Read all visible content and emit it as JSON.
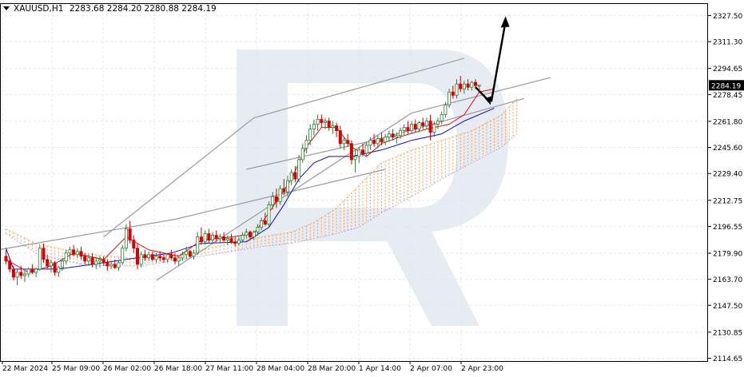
{
  "header": {
    "symbol": "XAUUSD,H1",
    "ohlc": "2283.68 2284.20 2280.88 2284.19"
  },
  "colors": {
    "grid": "#e4e4ec",
    "frame": "#000000",
    "candle_up": "#2e7d32",
    "candle_down": "#d50000",
    "tenkan": "#e01010",
    "kijun": "#1010c0",
    "cloud_a": "#f0a060",
    "cloud_b": "#b090e0",
    "channel": "#9a9a9a",
    "arrow": "#000000",
    "price_tag": "#000000",
    "watermark": "#dfe4ee"
  },
  "chart_data": {
    "type": "candlestick",
    "ylim": [
      2114.65,
      2334
    ],
    "yticks": [
      "2327.50",
      "2311.30",
      "2294.65",
      "2278.45",
      "2261.80",
      "2245.60",
      "2229.40",
      "2212.75",
      "2196.55",
      "2179.90",
      "2163.70",
      "2147.50",
      "2130.85",
      "2114.65"
    ],
    "xticks": [
      "22 Mar 2024",
      "25 Mar 09:00",
      "26 Mar 02:00",
      "26 Mar 18:00",
      "27 Mar 11:00",
      "28 Mar 04:00",
      "28 Mar 20:00",
      "1 Apr 14:00",
      "2 Apr 07:00",
      "2 Apr 23:00"
    ],
    "current_price": "2284.19",
    "bars": [
      [
        2178,
        2182,
        2173,
        2175
      ],
      [
        2175,
        2177,
        2168,
        2170
      ],
      [
        2170,
        2172,
        2163,
        2165
      ],
      [
        2165,
        2170,
        2160,
        2168
      ],
      [
        2168,
        2172,
        2164,
        2166
      ],
      [
        2166,
        2169,
        2162,
        2167
      ],
      [
        2167,
        2171,
        2165,
        2170
      ],
      [
        2170,
        2173,
        2167,
        2168
      ],
      [
        2168,
        2171,
        2165,
        2170
      ],
      [
        2170,
        2185,
        2169,
        2183
      ],
      [
        2183,
        2186,
        2174,
        2176
      ],
      [
        2176,
        2179,
        2170,
        2172
      ],
      [
        2172,
        2176,
        2168,
        2174
      ],
      [
        2174,
        2175,
        2166,
        2168
      ],
      [
        2168,
        2172,
        2165,
        2171
      ],
      [
        2171,
        2177,
        2169,
        2175
      ],
      [
        2175,
        2182,
        2173,
        2180
      ],
      [
        2180,
        2184,
        2176,
        2182
      ],
      [
        2182,
        2185,
        2178,
        2179
      ],
      [
        2179,
        2183,
        2177,
        2181
      ],
      [
        2181,
        2184,
        2176,
        2178
      ],
      [
        2178,
        2180,
        2173,
        2175
      ],
      [
        2175,
        2179,
        2172,
        2177
      ],
      [
        2177,
        2180,
        2171,
        2173
      ],
      [
        2173,
        2177,
        2170,
        2175
      ],
      [
        2175,
        2178,
        2171,
        2176
      ],
      [
        2176,
        2178,
        2172,
        2174
      ],
      [
        2174,
        2176,
        2169,
        2172
      ],
      [
        2172,
        2175,
        2170,
        2173
      ],
      [
        2173,
        2176,
        2170,
        2171
      ],
      [
        2171,
        2175,
        2169,
        2174
      ],
      [
        2174,
        2185,
        2173,
        2183
      ],
      [
        2183,
        2198,
        2181,
        2195
      ],
      [
        2195,
        2200,
        2186,
        2188
      ],
      [
        2188,
        2191,
        2180,
        2183
      ],
      [
        2183,
        2186,
        2170,
        2173
      ],
      [
        2173,
        2181,
        2171,
        2179
      ],
      [
        2179,
        2182,
        2175,
        2177
      ],
      [
        2177,
        2181,
        2175,
        2179
      ],
      [
        2179,
        2181,
        2175,
        2176
      ],
      [
        2176,
        2180,
        2174,
        2178
      ],
      [
        2178,
        2181,
        2175,
        2177
      ],
      [
        2177,
        2179,
        2174,
        2176
      ],
      [
        2176,
        2180,
        2174,
        2179
      ],
      [
        2179,
        2182,
        2176,
        2177
      ],
      [
        2177,
        2180,
        2173,
        2175
      ],
      [
        2175,
        2178,
        2172,
        2177
      ],
      [
        2177,
        2181,
        2175,
        2179
      ],
      [
        2179,
        2184,
        2176,
        2181
      ],
      [
        2181,
        2182,
        2177,
        2178
      ],
      [
        2178,
        2182,
        2176,
        2180
      ],
      [
        2180,
        2193,
        2179,
        2190
      ],
      [
        2190,
        2196,
        2185,
        2187
      ],
      [
        2187,
        2194,
        2185,
        2192
      ],
      [
        2192,
        2195,
        2186,
        2188
      ],
      [
        2188,
        2193,
        2186,
        2191
      ],
      [
        2191,
        2194,
        2187,
        2189
      ],
      [
        2189,
        2192,
        2186,
        2190
      ],
      [
        2190,
        2193,
        2187,
        2188
      ],
      [
        2188,
        2191,
        2185,
        2189
      ],
      [
        2189,
        2192,
        2186,
        2187
      ],
      [
        2187,
        2190,
        2184,
        2186
      ],
      [
        2186,
        2190,
        2185,
        2188
      ],
      [
        2188,
        2193,
        2187,
        2191
      ],
      [
        2191,
        2195,
        2189,
        2193
      ],
      [
        2193,
        2194,
        2188,
        2190
      ],
      [
        2190,
        2194,
        2188,
        2193
      ],
      [
        2193,
        2198,
        2191,
        2196
      ],
      [
        2196,
        2202,
        2194,
        2200
      ],
      [
        2200,
        2205,
        2197,
        2198
      ],
      [
        2198,
        2212,
        2196,
        2210
      ],
      [
        2210,
        2218,
        2207,
        2215
      ],
      [
        2215,
        2220,
        2208,
        2212
      ],
      [
        2212,
        2222,
        2210,
        2220
      ],
      [
        2220,
        2226,
        2216,
        2218
      ],
      [
        2218,
        2228,
        2215,
        2225
      ],
      [
        2225,
        2232,
        2222,
        2230
      ],
      [
        2230,
        2234,
        2224,
        2226
      ],
      [
        2226,
        2241,
        2224,
        2238
      ],
      [
        2238,
        2248,
        2236,
        2245
      ],
      [
        2245,
        2253,
        2242,
        2250
      ],
      [
        2250,
        2260,
        2247,
        2257
      ],
      [
        2257,
        2263,
        2253,
        2260
      ],
      [
        2260,
        2266,
        2256,
        2263
      ],
      [
        2263,
        2266,
        2258,
        2261
      ],
      [
        2261,
        2264,
        2257,
        2262
      ],
      [
        2262,
        2264,
        2256,
        2258
      ],
      [
        2258,
        2262,
        2254,
        2259
      ],
      [
        2259,
        2261,
        2252,
        2256
      ],
      [
        2256,
        2259,
        2245,
        2248
      ],
      [
        2248,
        2252,
        2244,
        2250
      ],
      [
        2250,
        2254,
        2246,
        2248
      ],
      [
        2248,
        2250,
        2235,
        2238
      ],
      [
        2238,
        2244,
        2230,
        2240
      ],
      [
        2240,
        2246,
        2236,
        2244
      ],
      [
        2244,
        2248,
        2240,
        2242
      ],
      [
        2242,
        2249,
        2240,
        2247
      ],
      [
        2247,
        2252,
        2244,
        2250
      ],
      [
        2250,
        2254,
        2246,
        2248
      ],
      [
        2248,
        2253,
        2245,
        2251
      ],
      [
        2251,
        2255,
        2247,
        2249
      ],
      [
        2249,
        2254,
        2247,
        2252
      ],
      [
        2252,
        2256,
        2249,
        2254
      ],
      [
        2254,
        2257,
        2250,
        2252
      ],
      [
        2252,
        2255,
        2248,
        2253
      ],
      [
        2253,
        2258,
        2251,
        2256
      ],
      [
        2256,
        2260,
        2253,
        2258
      ],
      [
        2258,
        2262,
        2254,
        2256
      ],
      [
        2256,
        2262,
        2254,
        2260
      ],
      [
        2260,
        2263,
        2255,
        2257
      ],
      [
        2257,
        2262,
        2255,
        2261
      ],
      [
        2261,
        2264,
        2257,
        2259
      ],
      [
        2259,
        2264,
        2257,
        2262
      ],
      [
        2262,
        2266,
        2250,
        2255
      ],
      [
        2255,
        2262,
        2252,
        2260
      ],
      [
        2260,
        2264,
        2257,
        2262
      ],
      [
        2262,
        2268,
        2260,
        2266
      ],
      [
        2266,
        2274,
        2264,
        2272
      ],
      [
        2272,
        2282,
        2270,
        2280
      ],
      [
        2280,
        2284,
        2276,
        2278
      ],
      [
        2278,
        2288,
        2276,
        2285
      ],
      [
        2285,
        2290,
        2280,
        2282
      ],
      [
        2282,
        2287,
        2279,
        2285
      ],
      [
        2285,
        2288,
        2281,
        2283
      ],
      [
        2283,
        2287,
        2281,
        2286
      ],
      [
        2286,
        2288,
        2282,
        2284
      ],
      [
        2283.68,
        2284.2,
        2280.88,
        2284.19
      ]
    ],
    "cloud": {
      "span_a": [
        [
          0,
          2195
        ],
        [
          8,
          2186
        ],
        [
          14,
          2183
        ],
        [
          20,
          2180
        ],
        [
          28,
          2178
        ],
        [
          36,
          2176
        ],
        [
          44,
          2178
        ],
        [
          52,
          2182
        ],
        [
          60,
          2186
        ],
        [
          68,
          2190
        ],
        [
          76,
          2193
        ],
        [
          82,
          2199
        ],
        [
          88,
          2208
        ],
        [
          94,
          2222
        ],
        [
          100,
          2236
        ],
        [
          108,
          2244
        ],
        [
          116,
          2250
        ],
        [
          124,
          2256
        ],
        [
          132,
          2266
        ],
        [
          136,
          2276
        ]
      ],
      "span_b": [
        [
          0,
          2192
        ],
        [
          8,
          2180
        ],
        [
          14,
          2176
        ],
        [
          20,
          2173
        ],
        [
          28,
          2172
        ],
        [
          36,
          2172
        ],
        [
          44,
          2175
        ],
        [
          52,
          2178
        ],
        [
          60,
          2181
        ],
        [
          68,
          2184
        ],
        [
          76,
          2186
        ],
        [
          82,
          2189
        ],
        [
          88,
          2192
        ],
        [
          94,
          2196
        ],
        [
          100,
          2205
        ],
        [
          108,
          2215
        ],
        [
          116,
          2226
        ],
        [
          124,
          2236
        ],
        [
          132,
          2246
        ],
        [
          136,
          2254
        ]
      ]
    },
    "tenkan": [
      [
        0,
        2176
      ],
      [
        6,
        2168
      ],
      [
        12,
        2172
      ],
      [
        18,
        2180
      ],
      [
        26,
        2176
      ],
      [
        32,
        2190
      ],
      [
        38,
        2182
      ],
      [
        46,
        2178
      ],
      [
        52,
        2188
      ],
      [
        60,
        2190
      ],
      [
        66,
        2192
      ],
      [
        70,
        2205
      ],
      [
        76,
        2226
      ],
      [
        80,
        2246
      ],
      [
        84,
        2258
      ],
      [
        88,
        2258
      ],
      [
        92,
        2246
      ],
      [
        96,
        2240
      ],
      [
        100,
        2248
      ],
      [
        106,
        2253
      ],
      [
        112,
        2257
      ],
      [
        118,
        2260
      ],
      [
        122,
        2266
      ],
      [
        126,
        2280
      ],
      [
        130,
        2282
      ]
    ],
    "kijun": [
      [
        0,
        2183
      ],
      [
        2,
        2170
      ],
      [
        14,
        2170
      ],
      [
        26,
        2174
      ],
      [
        32,
        2176
      ],
      [
        44,
        2180
      ],
      [
        52,
        2186
      ],
      [
        64,
        2187
      ],
      [
        70,
        2196
      ],
      [
        74,
        2210
      ],
      [
        78,
        2226
      ],
      [
        82,
        2236
      ],
      [
        86,
        2240
      ],
      [
        92,
        2240
      ],
      [
        100,
        2244
      ],
      [
        108,
        2250
      ],
      [
        116,
        2254
      ],
      [
        122,
        2262
      ],
      [
        126,
        2266
      ],
      [
        130,
        2270
      ]
    ],
    "channel_lines": [
      [
        [
          -7,
          2180
        ],
        [
          45,
          2201
        ],
        [
          101,
          2232
        ]
      ],
      [
        [
          26,
          2190
        ],
        [
          66,
          2264
        ],
        [
          122,
          2301
        ]
      ],
      [
        [
          40,
          2163
        ],
        [
          108,
          2267
        ],
        [
          145,
          2289
        ]
      ],
      [
        [
          64,
          2232
        ],
        [
          98,
          2250
        ],
        [
          138,
          2276
        ]
      ]
    ],
    "forecast_arrow": [
      [
        125,
        2283
      ],
      [
        129,
        2272
      ],
      [
        133,
        2327
      ]
    ]
  }
}
